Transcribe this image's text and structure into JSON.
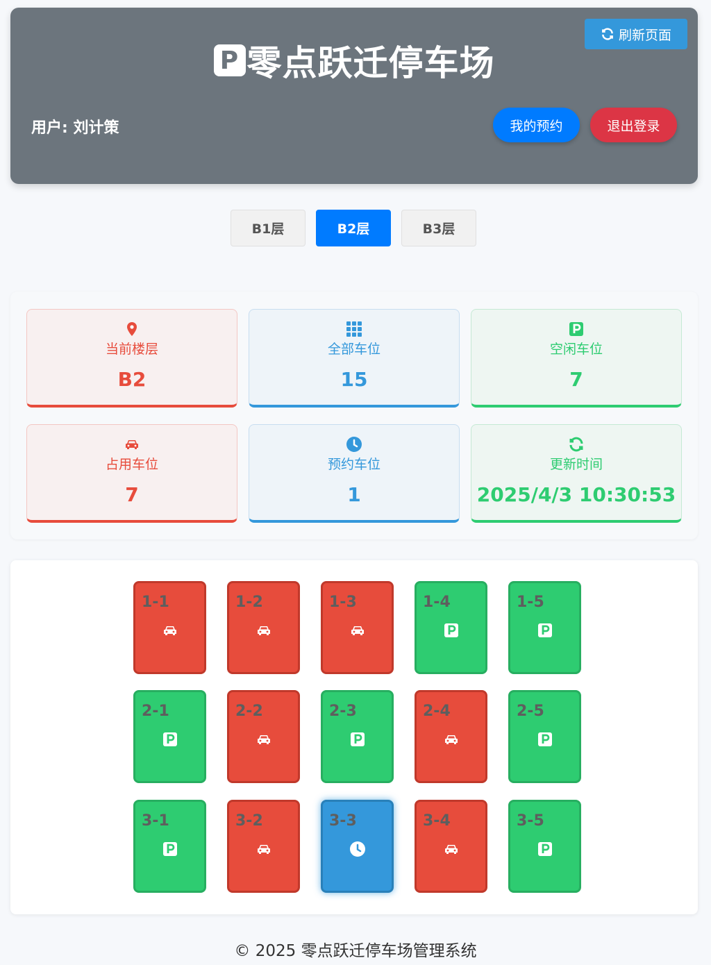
{
  "header": {
    "title": "零点跃迁停车场",
    "logo_letter": "P",
    "refresh_label": "刷新页面",
    "user_label": "用户: 刘计策",
    "my_reservations_label": "我的预约",
    "logout_label": "退出登录"
  },
  "floors": {
    "tabs": [
      "B1层",
      "B2层",
      "B3层"
    ],
    "active": "B2层"
  },
  "stats": [
    {
      "label": "当前楼层",
      "value": "B2",
      "color": "#e74c3c",
      "icon": "map-marker-icon"
    },
    {
      "label": "全部车位",
      "value": "15",
      "color": "#3498db",
      "icon": "grid-icon"
    },
    {
      "label": "空闲车位",
      "value": "7",
      "color": "#2ecc71",
      "icon": "parking-icon"
    },
    {
      "label": "占用车位",
      "value": "7",
      "color": "#e74c3c",
      "icon": "car-icon"
    },
    {
      "label": "预约车位",
      "value": "1",
      "color": "#3498db",
      "icon": "clock-icon"
    },
    {
      "label": "更新时间",
      "value": "2025/4/3 10:30:53",
      "color": "#2ecc71",
      "icon": "refresh-icon"
    }
  ],
  "spots": [
    {
      "id": "1-1",
      "status": "occupied"
    },
    {
      "id": "1-2",
      "status": "occupied"
    },
    {
      "id": "1-3",
      "status": "occupied"
    },
    {
      "id": "1-4",
      "status": "free"
    },
    {
      "id": "1-5",
      "status": "free"
    },
    {
      "id": "2-1",
      "status": "free"
    },
    {
      "id": "2-2",
      "status": "occupied"
    },
    {
      "id": "2-3",
      "status": "free"
    },
    {
      "id": "2-4",
      "status": "occupied"
    },
    {
      "id": "2-5",
      "status": "free"
    },
    {
      "id": "3-1",
      "status": "free"
    },
    {
      "id": "3-2",
      "status": "occupied"
    },
    {
      "id": "3-3",
      "status": "reserved"
    },
    {
      "id": "3-4",
      "status": "occupied"
    },
    {
      "id": "3-5",
      "status": "free"
    }
  ],
  "colors": {
    "occupied": "#e74c3c",
    "free": "#2ecc71",
    "reserved": "#3498db",
    "header_bg": "#6c757d"
  },
  "footer": {
    "text": "© 2025 零点跃迁停车场管理系统"
  }
}
